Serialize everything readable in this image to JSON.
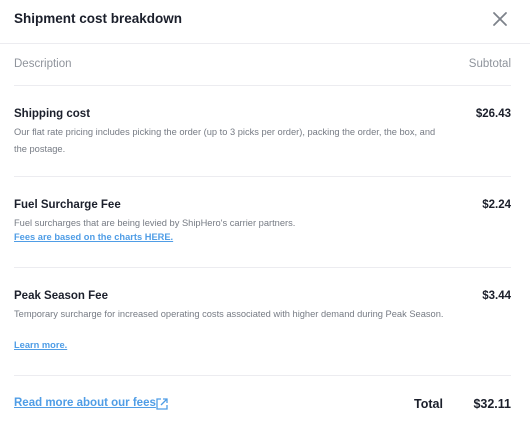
{
  "header": {
    "title": "Shipment cost breakdown",
    "close_icon": "close-icon"
  },
  "table": {
    "col_description": "Description",
    "col_subtotal": "Subtotal"
  },
  "fees": [
    {
      "name": "Shipping cost",
      "amount": "$26.43",
      "description": "Our flat rate pricing includes picking the order (up to 3 picks per order), packing the order, the box, and the postage."
    },
    {
      "name": "Fuel Surcharge Fee",
      "amount": "$2.24",
      "description": "Fuel surcharges that are being levied by ShipHero's carrier partners.",
      "link": "Fees are based on the charts HERE."
    },
    {
      "name": "Peak Season Fee",
      "amount": "$3.44",
      "description": "Temporary surcharge for increased operating costs associated with higher demand during Peak Season.",
      "link": "Learn more."
    }
  ],
  "footer": {
    "read_more_link": "Read more about our fees",
    "external_icon": "external-link-icon",
    "total_label": "Total",
    "total_value": "$32.11"
  },
  "colors": {
    "link": "#4f9de6",
    "text": "#1b1f2b",
    "muted": "#767b84"
  }
}
